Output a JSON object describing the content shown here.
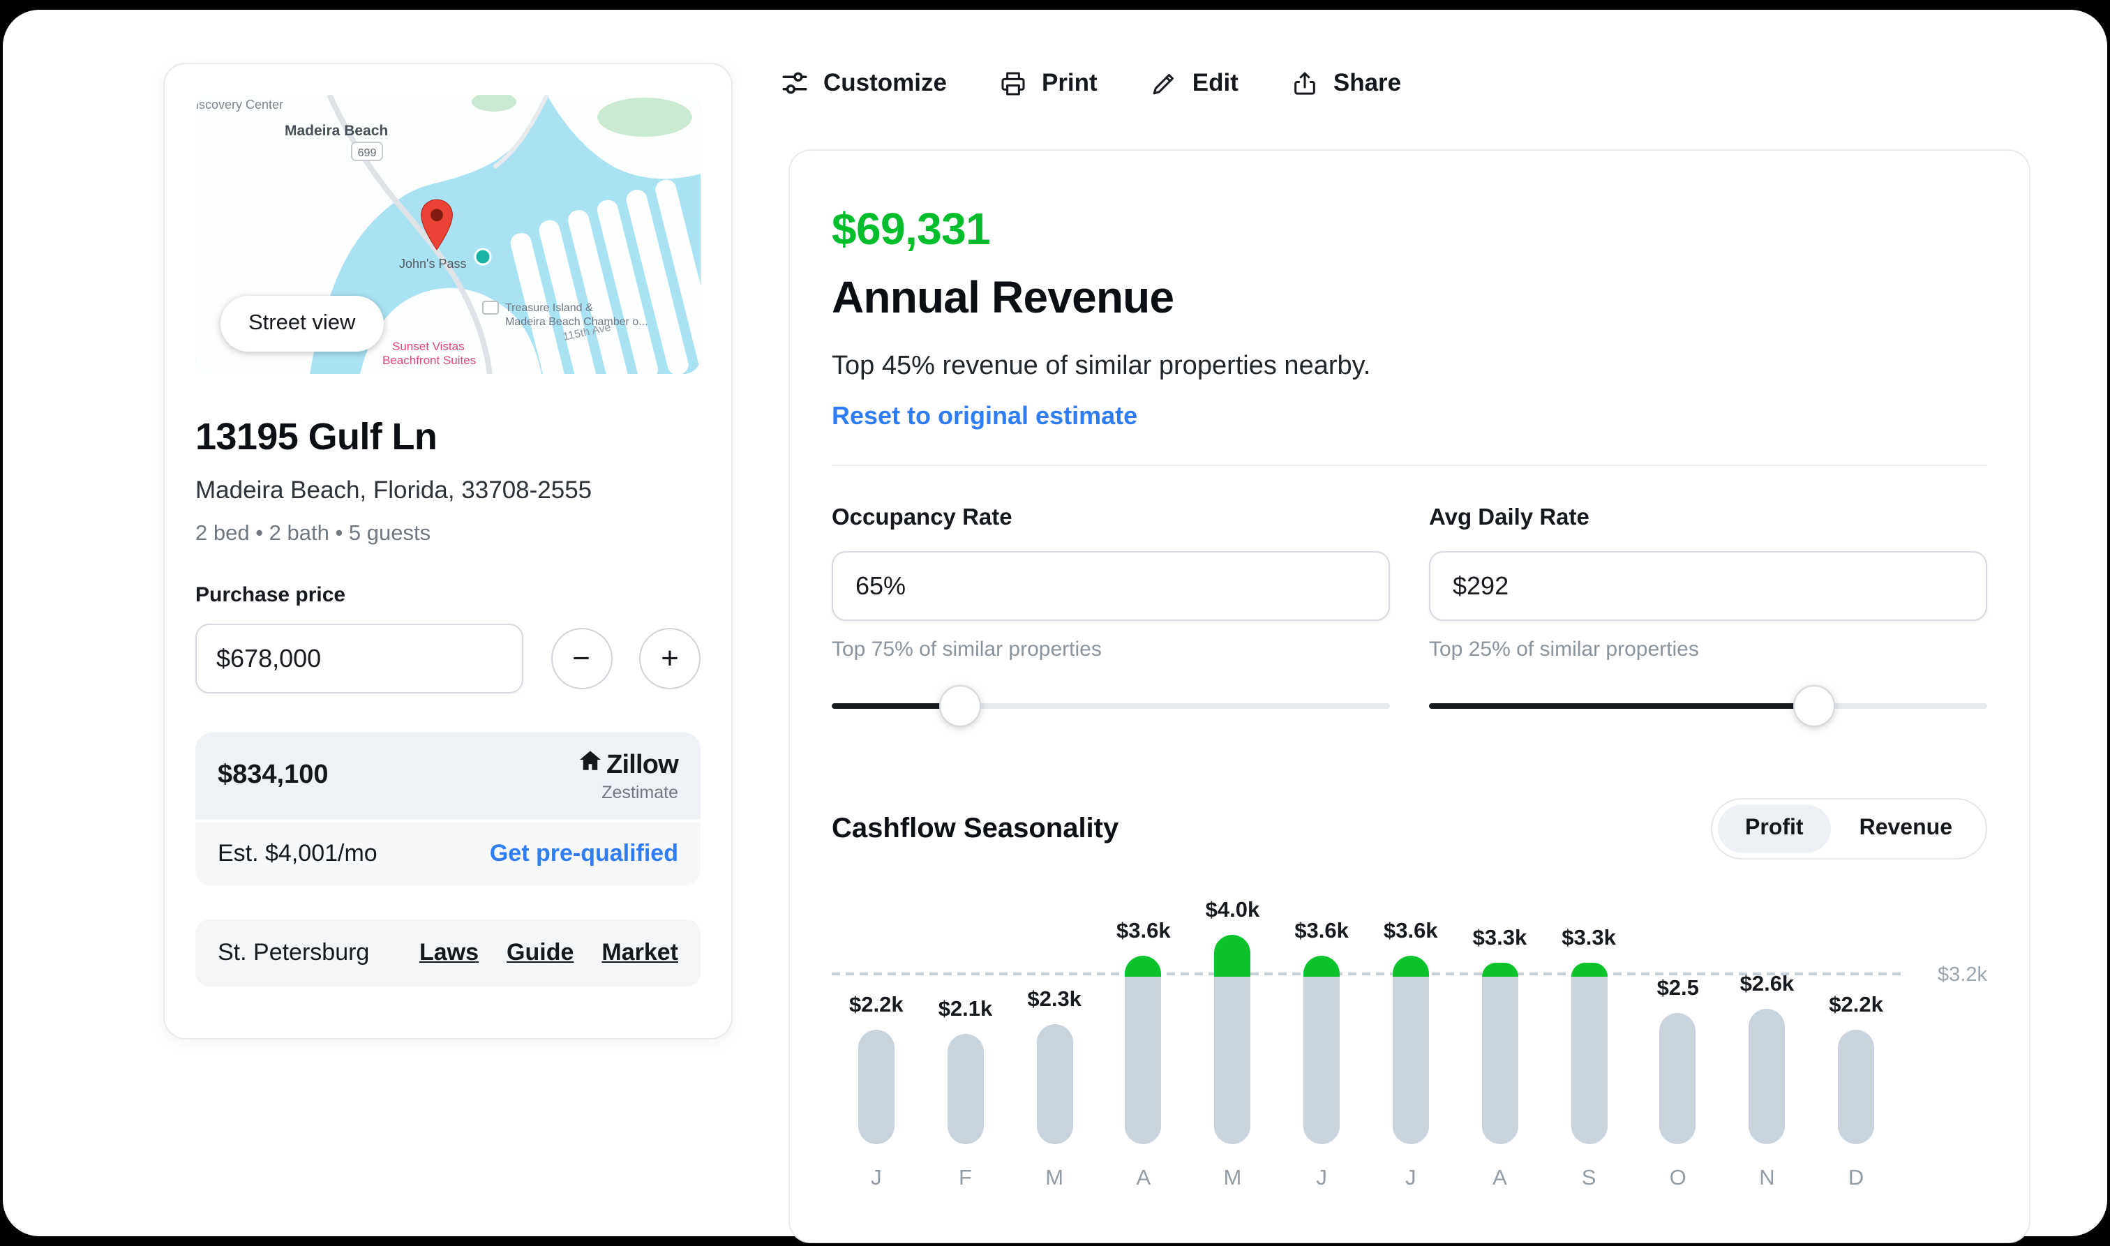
{
  "colors": {
    "accent_green": "#00bd2c",
    "link_blue": "#2e7cf6",
    "bar_gray": "#c8d3de",
    "bar_green": "#0cc32c",
    "map_pin_red": "#ea4335"
  },
  "toolbar": {
    "customize": "Customize",
    "print": "Print",
    "edit": "Edit",
    "share": "Share"
  },
  "property": {
    "street_view": "Street view",
    "address": "13195 Gulf Ln",
    "location": "Madeira Beach, Florida, 33708-2555",
    "specs": "2 bed • 2 bath • 5 guests",
    "purchase_price_label": "Purchase price",
    "purchase_price": "$678,000",
    "stepper_minus": "−",
    "stepper_plus": "+",
    "zestimate_value": "$834,100",
    "zillow_brand": "Zillow",
    "zestimate_label": "Zestimate",
    "monthly_estimate": "Est. $4,001/mo",
    "prequalify_link": "Get pre-qualified",
    "market_city": "St. Petersburg",
    "market_links": [
      "Laws",
      "Guide",
      "Market"
    ]
  },
  "map": {
    "labels": {
      "discovery": "Discovery Center",
      "madeira": "Madeira Beach",
      "route_badge": "699",
      "johns_pass": "John's Pass",
      "chamber_line1": "Treasure Island &",
      "chamber_line2": "Madeira Beach Chamber o...",
      "sunset_line1": "Sunset Vistas",
      "sunset_line2": "Beachfront Suites",
      "street": "115th Ave"
    }
  },
  "revenue": {
    "amount": "$69,331",
    "title": "Annual Revenue",
    "subtitle": "Top 45% revenue of similar properties nearby.",
    "reset_link": "Reset to original estimate"
  },
  "controls": {
    "occupancy": {
      "label": "Occupancy Rate",
      "value": "65%",
      "hint": "Top 75% of similar properties",
      "slider_pct": 23
    },
    "daily_rate": {
      "label": "Avg Daily Rate",
      "value": "$292",
      "hint": "Top 25% of similar properties",
      "slider_pct": 69
    }
  },
  "seasonality": {
    "title": "Cashflow Seasonality",
    "toggle_profit": "Profit",
    "toggle_revenue": "Revenue",
    "selected": "Profit"
  },
  "chart_data": {
    "type": "bar",
    "title": "Cashflow Seasonality",
    "categories": [
      "J",
      "F",
      "M",
      "A",
      "M",
      "J",
      "J",
      "A",
      "S",
      "O",
      "N",
      "D"
    ],
    "values": [
      2.2,
      2.1,
      2.3,
      3.6,
      4.0,
      3.6,
      3.6,
      3.3,
      3.3,
      2.5,
      2.6,
      2.2
    ],
    "labels": [
      "$2.2k",
      "$2.1k",
      "$2.3k",
      "$3.6k",
      "$4.0k",
      "$3.6k",
      "$3.6k",
      "$3.3k",
      "$3.3k",
      "$2.5",
      "$2.6k",
      "$2.2k"
    ],
    "unit": "USD thousands per month",
    "threshold": 3.2,
    "threshold_label": "$3.2k",
    "ylim": [
      0,
      4.0
    ],
    "legend": "none",
    "grid": "dashed-threshold-line-only"
  }
}
